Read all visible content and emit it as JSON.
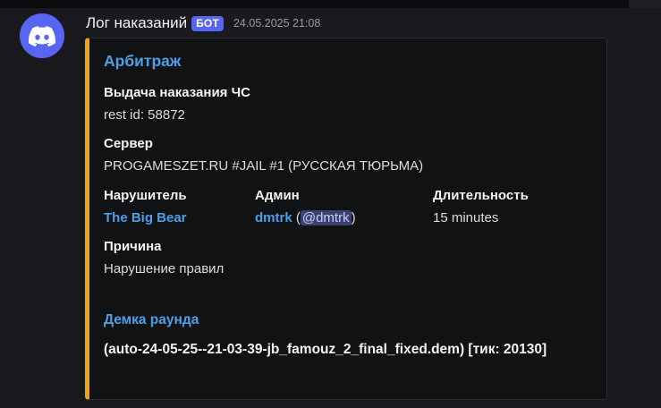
{
  "message": {
    "author": "Лог наказаний",
    "bot_tag": "БОТ",
    "timestamp": "24.05.2025 21:08",
    "avatar_icon": "discord-logo-icon"
  },
  "embed": {
    "accent_color": "#f0a30a",
    "title": "Арбитраж",
    "fields": {
      "action": {
        "name": "Выдача наказания ЧС",
        "value": "rest id: 58872"
      },
      "server": {
        "name": "Сервер",
        "value": "PROGAMESZET.RU #JAIL #1 (РУССКАЯ ТЮРЬМА)"
      },
      "offender": {
        "name": "Нарушитель",
        "value": "The Big Bear"
      },
      "admin": {
        "name": "Админ",
        "value": "dmtrk",
        "open_paren": " (",
        "mention": "@dmtrk",
        "close_paren": ")"
      },
      "duration": {
        "name": "Длительность",
        "value": "15 minutes"
      },
      "reason": {
        "name": "Причина",
        "value": "Нарушение правил"
      }
    },
    "demo": {
      "title": "Демка раунда",
      "file": "(auto-24-05-25--21-03-39-jb_famouz_2_final_fixed.dem) [тик: 20130]"
    }
  }
}
